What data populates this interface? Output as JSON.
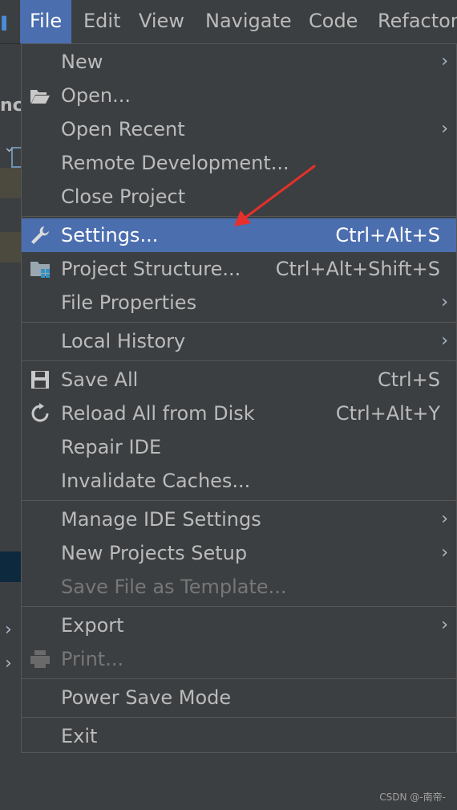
{
  "menubar": {
    "items": [
      {
        "label": "File"
      },
      {
        "label": "Edit"
      },
      {
        "label": "View"
      },
      {
        "label": "Navigate"
      },
      {
        "label": "Code"
      },
      {
        "label": "Refactor"
      }
    ]
  },
  "left_panel": {
    "partial_text": "nc"
  },
  "file_menu": {
    "items": [
      {
        "label": "New",
        "submenu": true
      },
      {
        "label": "Open...",
        "icon": "folder-open-icon"
      },
      {
        "label": "Open Recent",
        "submenu": true
      },
      {
        "label": "Remote Development..."
      },
      {
        "label": "Close Project"
      },
      {
        "label": "Settings...",
        "shortcut": "Ctrl+Alt+S",
        "icon": "wrench-icon",
        "selected": true
      },
      {
        "label": "Project Structure...",
        "shortcut": "Ctrl+Alt+Shift+S",
        "icon": "project-structure-icon"
      },
      {
        "label": "File Properties",
        "submenu": true
      },
      {
        "label": "Local History",
        "submenu": true
      },
      {
        "label": "Save All",
        "shortcut": "Ctrl+S",
        "icon": "floppy-disk-icon"
      },
      {
        "label": "Reload All from Disk",
        "shortcut": "Ctrl+Alt+Y",
        "icon": "reload-icon"
      },
      {
        "label": "Repair IDE"
      },
      {
        "label": "Invalidate Caches..."
      },
      {
        "label": "Manage IDE Settings",
        "submenu": true
      },
      {
        "label": "New Projects Setup",
        "submenu": true
      },
      {
        "label": "Save File as Template...",
        "disabled": true
      },
      {
        "label": "Export",
        "submenu": true
      },
      {
        "label": "Print...",
        "disabled": true,
        "icon": "printer-icon"
      },
      {
        "label": "Power Save Mode"
      },
      {
        "label": "Exit"
      }
    ]
  },
  "arrow_glyph": "›",
  "chevron_right": "›",
  "chevron_down": "⌄",
  "colors": {
    "menu_bg": "#3c3f41",
    "selection": "#4b6eaf",
    "text": "#bbbbbb",
    "disabled_text": "#777777",
    "annotation_arrow": "#e8302a"
  },
  "watermark": "CSDN @-南帝-"
}
